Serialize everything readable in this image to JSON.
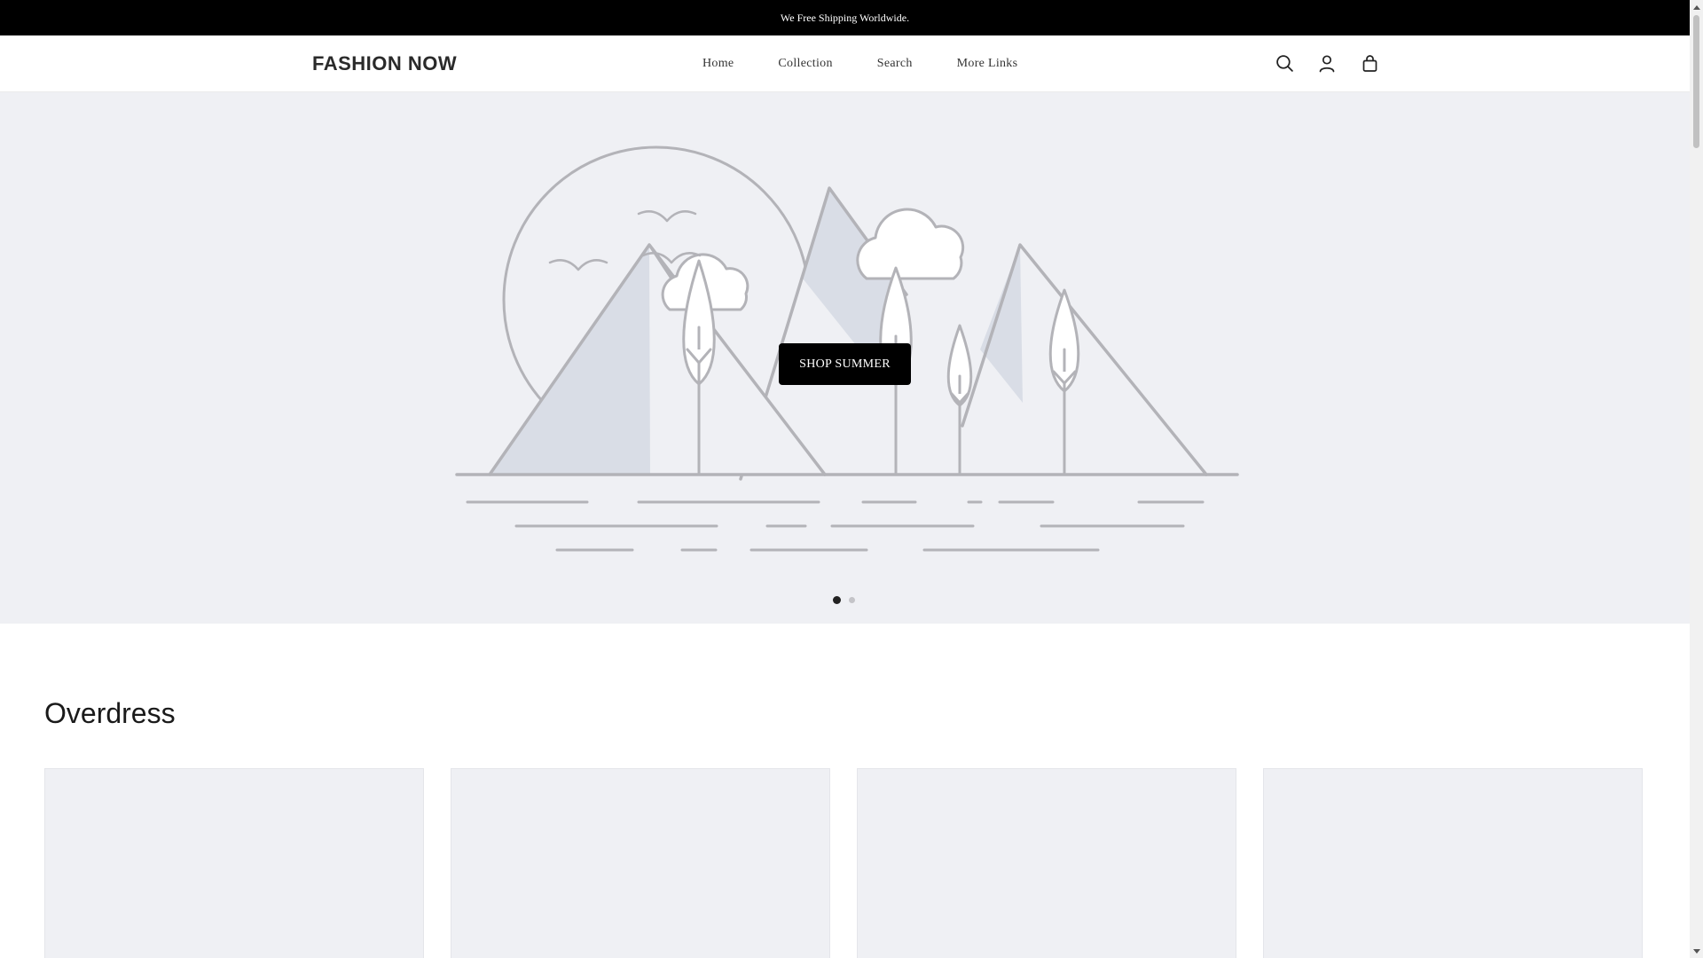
{
  "announcement": {
    "text": "We Free Shipping Worldwide."
  },
  "header": {
    "logo": "FASHION NOW",
    "nav": [
      "Home",
      "Collection",
      "Search",
      "More Links"
    ],
    "icons": [
      "search-icon",
      "account-icon",
      "cart-icon"
    ]
  },
  "hero": {
    "cta_label": "SHOP SUMMER",
    "slides": {
      "current": 1,
      "total": 2
    }
  },
  "collection": {
    "title": "Overdress",
    "card_count": 4
  },
  "colors": {
    "announcement_bg": "#000000",
    "hero_bg": "#eff0f4",
    "cta_bg": "#000000",
    "placeholder_stroke": "#b3b3b8",
    "placeholder_fill": "#d9dde6"
  }
}
